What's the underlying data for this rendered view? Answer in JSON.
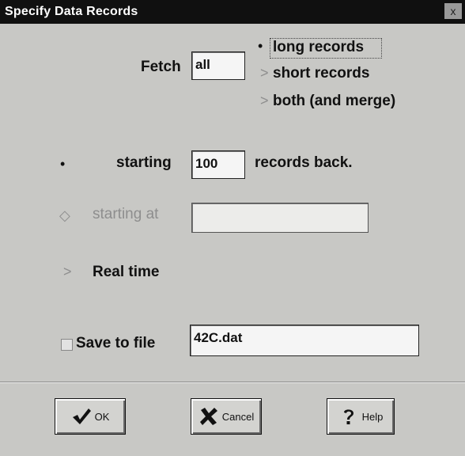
{
  "window": {
    "title": "Specify Data Records",
    "close_glyph": "x"
  },
  "fetch": {
    "label": "Fetch",
    "value": "all",
    "options": [
      {
        "label": "long records",
        "selected": true,
        "glyph": "•"
      },
      {
        "label": "short records",
        "selected": false,
        "glyph": ">"
      },
      {
        "label": "both (and merge)",
        "selected": false,
        "glyph": ">"
      }
    ]
  },
  "mode": {
    "starting": {
      "radio_glyph": "•",
      "label": "starting",
      "value": "100",
      "suffix": "records back."
    },
    "starting_at": {
      "radio_glyph": "◇",
      "label": "starting at",
      "value": ""
    },
    "real_time": {
      "radio_glyph": ">",
      "label": "Real time"
    }
  },
  "save": {
    "label": "Save to file",
    "value": "42C.dat",
    "checked": false
  },
  "buttons": {
    "ok": "OK",
    "cancel": "Cancel",
    "help": "Help"
  },
  "colors": {
    "dialog_bg": "#c8c8c5",
    "titlebar_bg": "#101010",
    "disabled_text": "#8e8e8e"
  }
}
